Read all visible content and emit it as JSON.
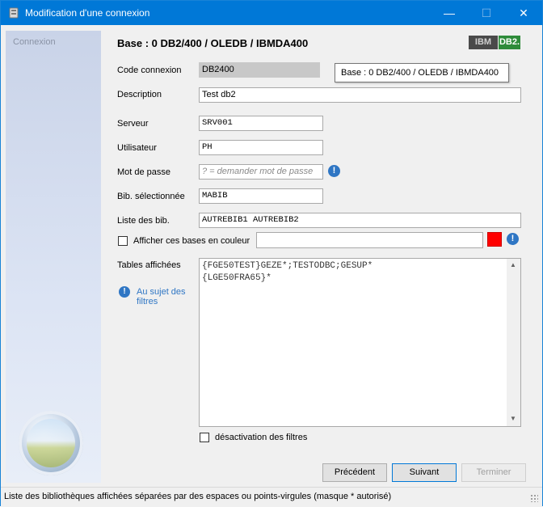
{
  "window": {
    "title": "Modification d'une connexion",
    "minimize": "—",
    "maximize": "☐",
    "close": "✕"
  },
  "sidebar": {
    "label": "Connexion"
  },
  "header": {
    "base_title": "Base :  0 DB2/400 / OLEDB / IBMDA400",
    "logo_ibm": "IBM",
    "logo_db2": "DB2."
  },
  "tooltip": {
    "text": "Base :  0 DB2/400 / OLEDB / IBMDA400"
  },
  "form": {
    "code_label": "Code connexion",
    "code_value": "DB2400",
    "description_label": "Description",
    "description_value": "Test db2",
    "serveur_label": "Serveur",
    "serveur_value": "SRV001",
    "utilisateur_label": "Utilisateur",
    "utilisateur_value": "PH",
    "password_label": "Mot de passe",
    "password_placeholder": "? = demander mot de passe",
    "bib_sel_label": "Bib. sélectionnée",
    "bib_sel_value": "MABIB",
    "liste_bib_label": "Liste des bib.",
    "liste_bib_value": "AUTREBIB1 AUTREBIB2",
    "couleur_label": "Afficher ces bases en couleur",
    "couleur_value": "",
    "couleur_swatch": "#ff0000",
    "tables_label": "Tables affichées",
    "tables_line1": "{FGE50TEST}GEZE*;TESTODBC;GESUP*",
    "tables_line2": "{LGE50FRA65}*",
    "about_filters": "Au sujet des filtres",
    "desactivation_label": "désactivation des filtres"
  },
  "buttons": {
    "precedent": "Précédent",
    "suivant": "Suivant",
    "terminer": "Terminer"
  },
  "status": {
    "text": "Liste des bibliothèques affichées séparées par des espaces ou points-virgules (masque * autorisé)"
  },
  "colors": {
    "titlebar": "#0078d7",
    "accent_link": "#2f76c4",
    "swatch": "#ff0000"
  }
}
